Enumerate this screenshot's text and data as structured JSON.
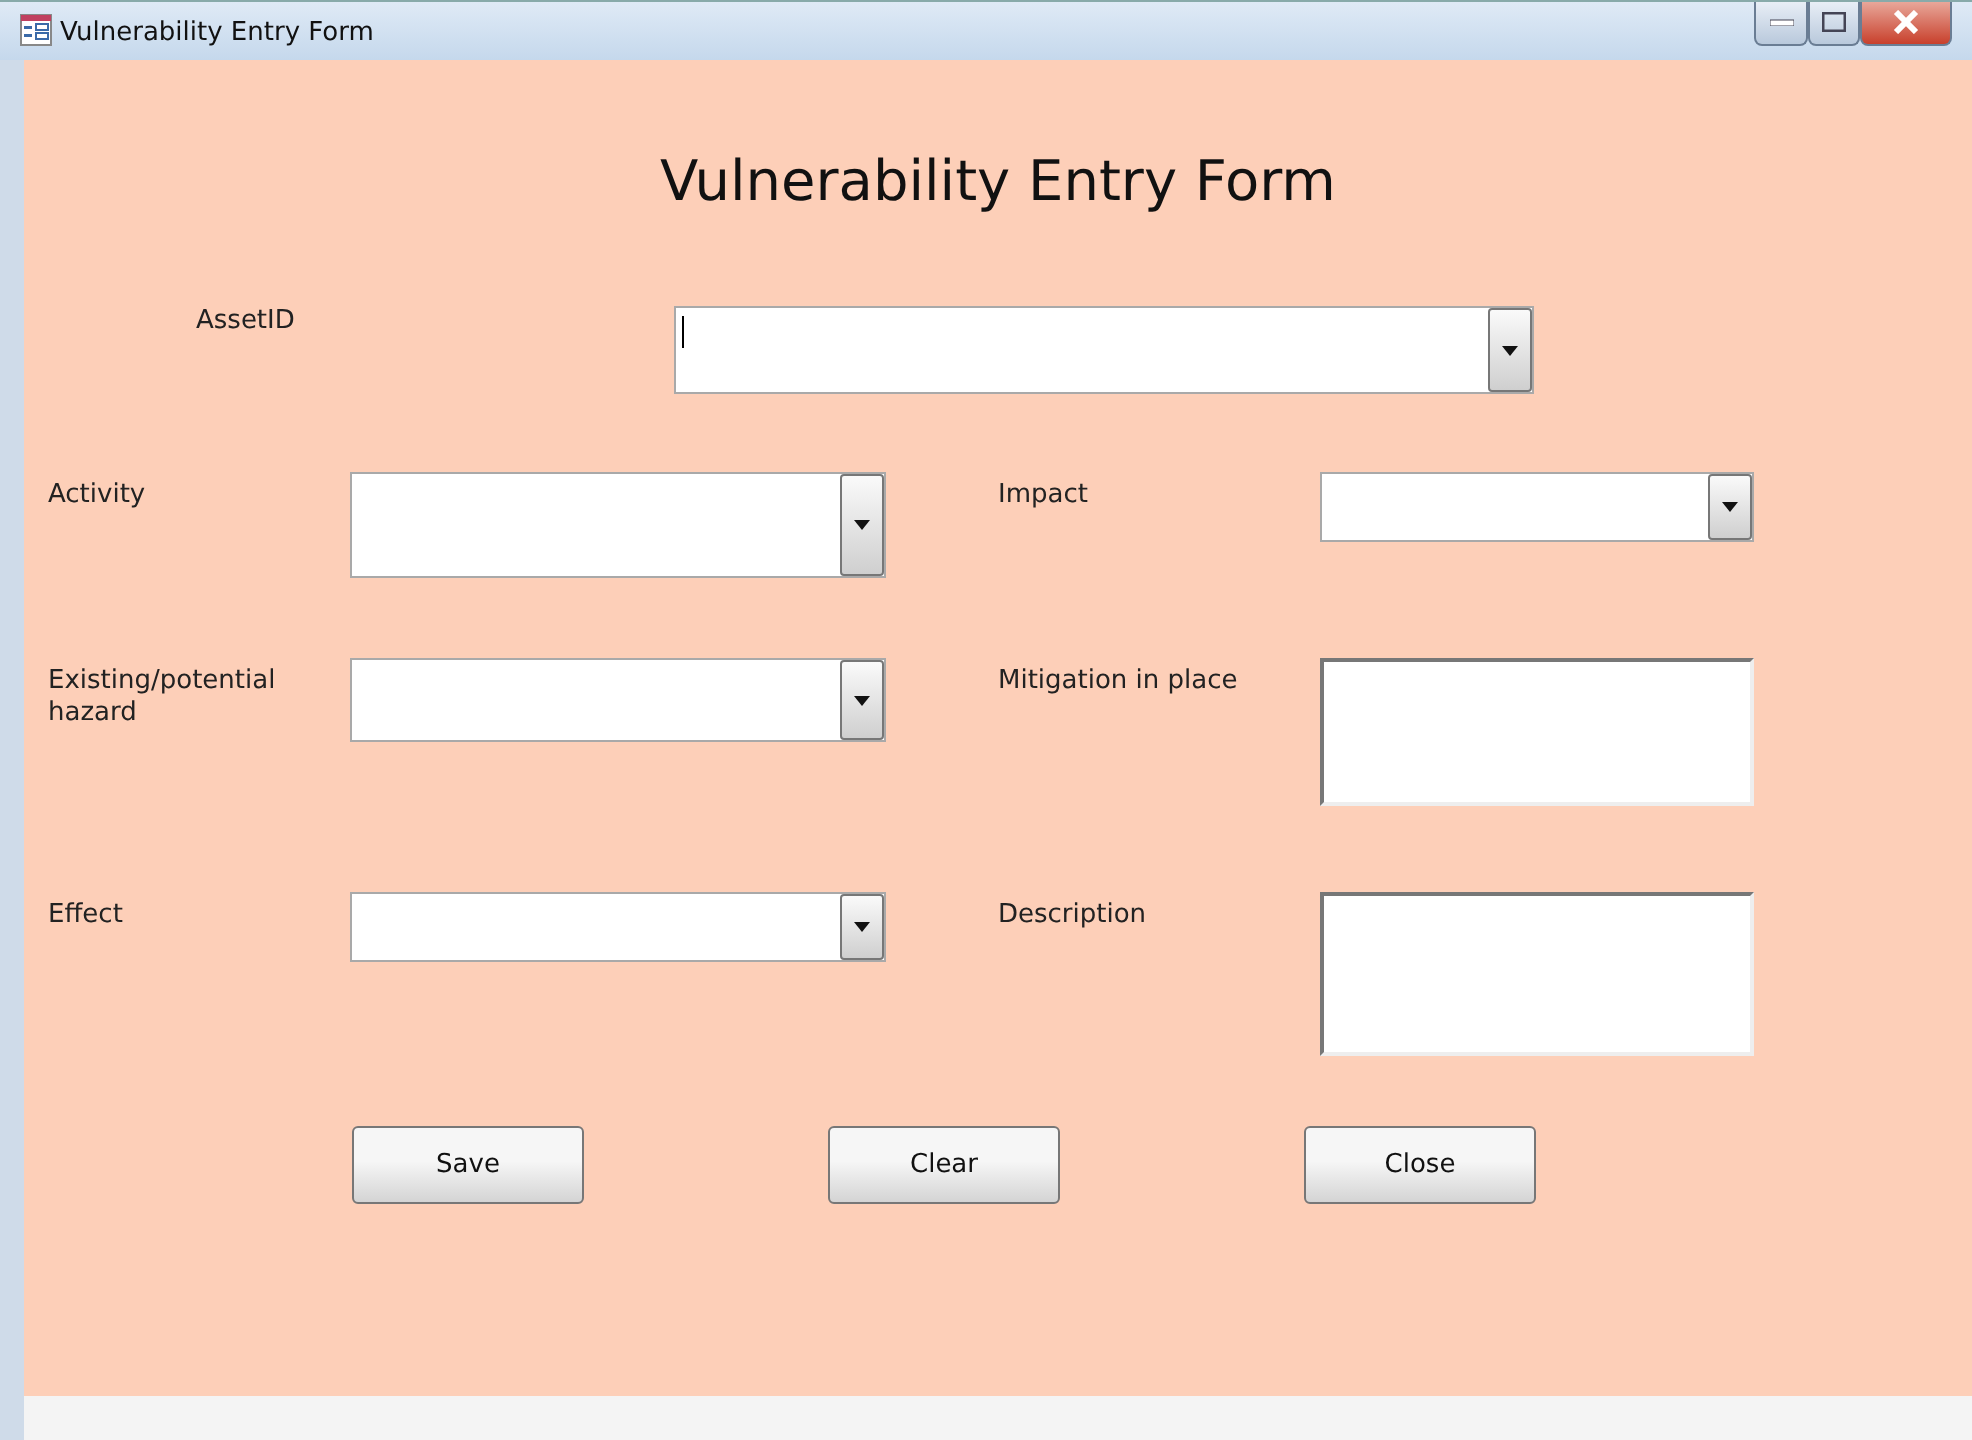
{
  "window": {
    "title": "Vulnerability Entry Form"
  },
  "form_title": "Vulnerability Entry Form",
  "asset": {
    "label": "AssetID",
    "kind": "combo",
    "focused": true
  },
  "rows": [
    {
      "left": {
        "label": "Activity",
        "kind": "combo"
      },
      "right": {
        "label": "Impact",
        "kind": "combo"
      }
    },
    {
      "left": {
        "label": "Existing/potential hazard",
        "kind": "combo"
      },
      "right": {
        "label": "Mitigation in place",
        "kind": "textbox"
      }
    },
    {
      "left": {
        "label": "Effect",
        "kind": "combo"
      },
      "right": {
        "label": "Description",
        "kind": "textbox"
      }
    }
  ],
  "buttons": [
    "Save",
    "Clear",
    "Close"
  ]
}
